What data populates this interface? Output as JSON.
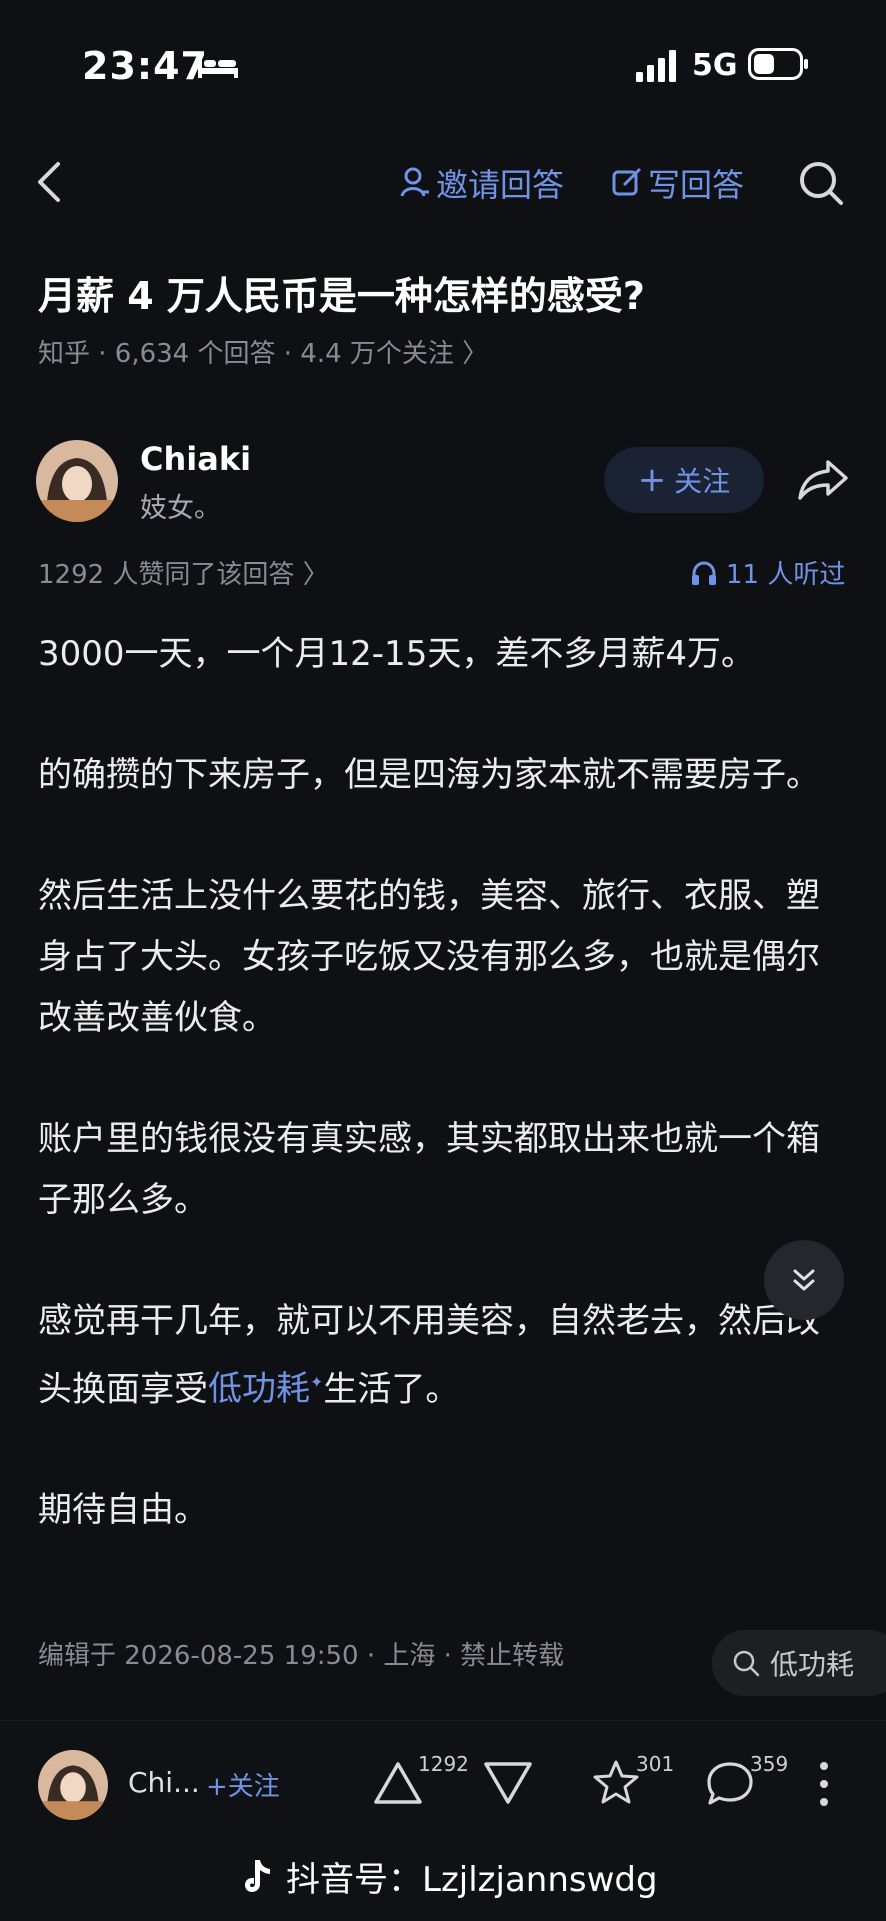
{
  "status": {
    "time": "23:47",
    "network": "5G"
  },
  "nav": {
    "invite_label": "邀请回答",
    "write_label": "写回答"
  },
  "question": {
    "title": "月薪 4 万人民币是一种怎样的感受?",
    "meta": "知乎 · 6,634 个回答 · 4.4 万个关注 〉"
  },
  "author": {
    "name": "Chiaki",
    "bio": "妓女。",
    "follow_label": "关注"
  },
  "answer": {
    "likes_text": "1292 人赞同了该回答 〉",
    "listen_text": "11 人听过",
    "paragraphs": [
      "3000一天，一个月12-15天，差不多月薪4万。",
      "的确攒的下来房子，但是四海为家本就不需要房子。",
      "然后生活上没什么要花的钱，美容、旅行、衣服、塑身占了大头。女孩子吃饭又没有那么多，也就是偶尔改善改善伙食。",
      "账户里的钱很没有真实感，其实都取出来也就一个箱子那么多。"
    ],
    "p5_before": "感觉再干几年，就可以不用美容，自然老去，然后改头换面享受",
    "p5_keyword": "低功耗",
    "p5_after": "生活了。",
    "p6": "期待自由。",
    "edit_line": "编辑于 2026-08-25 19:50 · 上海 · 禁止转载",
    "keyword_chip": "低功耗"
  },
  "bottom": {
    "name_short": "Chi...",
    "follow_label": "+关注",
    "upvotes": "1292",
    "favorites": "301",
    "comments": "359"
  },
  "watermark": "抖音号：Lzjlzjannswdg",
  "colors": {
    "accent": "#6f94e6",
    "background": "#0f1014"
  }
}
